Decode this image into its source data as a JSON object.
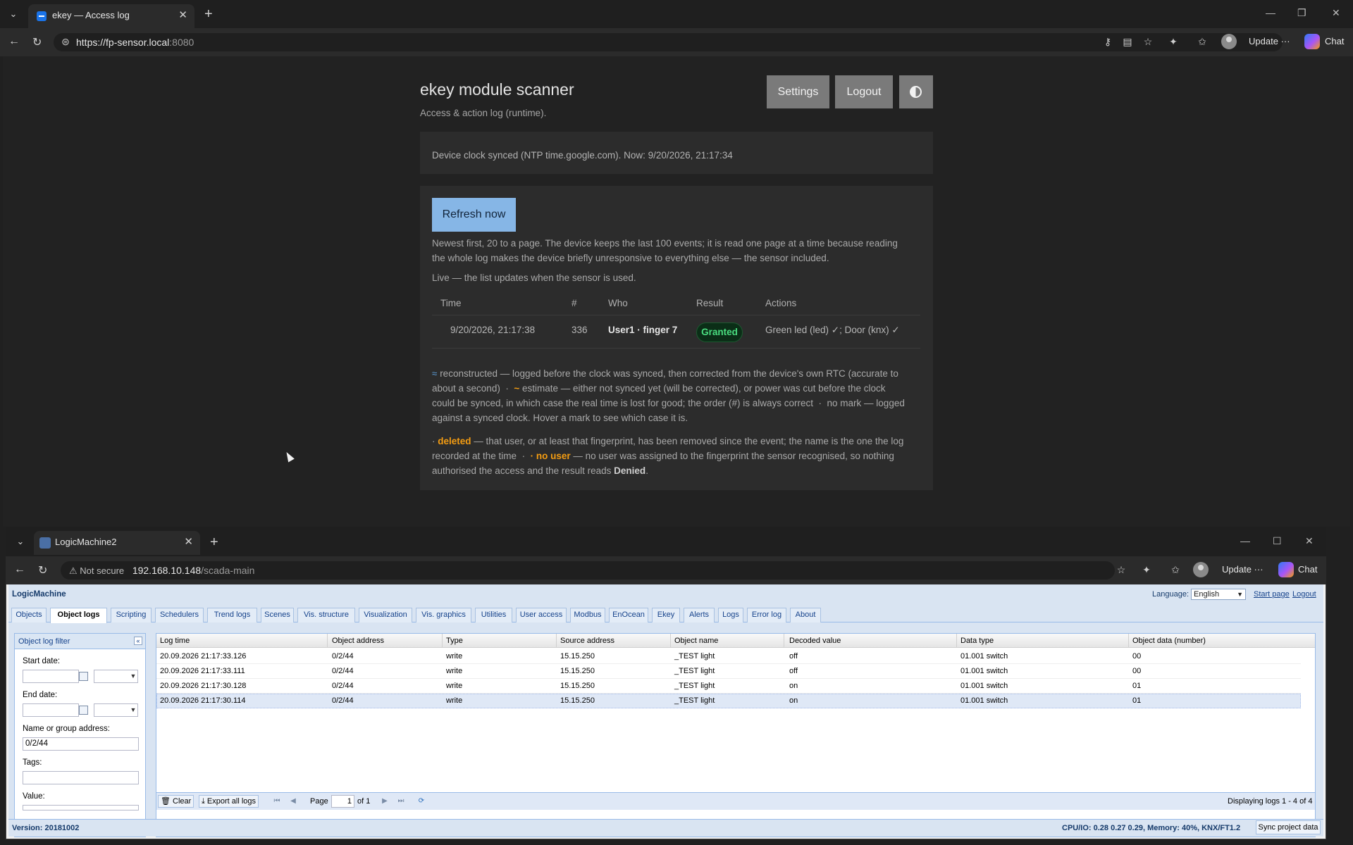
{
  "outer_browser": {
    "tab_title": "ekey — Access log",
    "address_host": "https://fp-sensor.local",
    "address_port": ":8080",
    "update_label": "Update",
    "chat_label": "Chat"
  },
  "ekey": {
    "title": "ekey module scanner",
    "subtitle": "Access & action log (runtime).",
    "settings_label": "Settings",
    "logout_label": "Logout",
    "clock_status": "Device clock synced (NTP time.google.com). Now: 9/20/2026, 21:17:34",
    "refresh_label": "Refresh now",
    "info_line1": "Newest first, 20 to a page. The device keeps the last 100 events; it is read one page at a time because reading",
    "info_line2": "the whole log makes the device briefly unresponsive to everything else — the sensor included.",
    "live_text": "Live — the list updates when the sensor is used.",
    "table_headers": {
      "time": "Time",
      "num": "#",
      "who": "Who",
      "result": "Result",
      "actions": "Actions"
    },
    "rows": [
      {
        "time": "9/20/2026, 21:17:38",
        "num": "336",
        "who": "User1 · finger 7",
        "result": "Granted",
        "actions": "Green led (led) ✓; Door (knx) ✓"
      }
    ],
    "legend_marks": {
      "reconstructed_mark": "≈",
      "reconstructed_text": "reconstructed — logged before the clock was synced, then corrected from the device's own RTC (accurate to",
      "reconstructed_text2": "about a second)",
      "sep": "·",
      "estimate_mark": "~",
      "estimate_text": "estimate — either not synced yet (will be corrected), or power was cut before the clock",
      "estimate_text2": "could be synced, in which case the real time is lost for good; the order (#) is always correct",
      "nomark_text": "no mark — logged",
      "nomark_text2": "against a synced clock. Hover a mark to see which case it is."
    },
    "legend_users": {
      "deleted_label": "deleted",
      "deleted_text": "— that user, or at least that fingerprint, has been removed since the event; the name is the one the log",
      "deleted_text2": "recorded at the time",
      "nouser_label": "no user",
      "nouser_text": "— no user was assigned to the fingerprint the sensor recognised, so nothing",
      "nouser_text2": "authorised the access and the result reads",
      "denied": "Denied"
    }
  },
  "inner_browser": {
    "tab_title": "LogicMachine2",
    "not_secure": "Not secure",
    "address_host": "192.168.10.148",
    "address_path": "/scada-main",
    "update_label": "Update",
    "chat_label": "Chat"
  },
  "lm": {
    "logo": "LogicMachine",
    "language_label": "Language:",
    "language_value": "English",
    "start_page": "Start page",
    "logout": "Logout",
    "tabs": [
      "Objects",
      "Object logs",
      "Scripting",
      "Schedulers",
      "Trend logs",
      "Scenes",
      "Vis. structure",
      "Visualization",
      "Vis. graphics",
      "Utilities",
      "User access",
      "Modbus",
      "EnOcean",
      "Ekey",
      "Alerts",
      "Logs",
      "Error log",
      "About"
    ],
    "active_tab": "Object logs",
    "filter": {
      "title": "Object log filter",
      "start_date": "Start date:",
      "end_date": "End date:",
      "name_label": "Name or group address:",
      "name_value": "0/2/44",
      "tags_label": "Tags:",
      "value_label": "Value:"
    },
    "grid_headers": [
      "Log time",
      "Object address",
      "Type",
      "Source address",
      "Object name",
      "Decoded value",
      "Data type",
      "Object data (number)"
    ],
    "grid_rows": [
      [
        "20.09.2026 21:17:33.126",
        "0/2/44",
        "write",
        "15.15.250",
        "_TEST light",
        "off",
        "01.001 switch",
        "00"
      ],
      [
        "20.09.2026 21:17:33.111",
        "0/2/44",
        "write",
        "15.15.250",
        "_TEST light",
        "off",
        "01.001 switch",
        "00"
      ],
      [
        "20.09.2026 21:17:30.128",
        "0/2/44",
        "write",
        "15.15.250",
        "_TEST light",
        "on",
        "01.001 switch",
        "01"
      ],
      [
        "20.09.2026 21:17:30.114",
        "0/2/44",
        "write",
        "15.15.250",
        "_TEST light",
        "on",
        "01.001 switch",
        "01"
      ]
    ],
    "pager": {
      "clear": "Clear",
      "export": "Export all logs",
      "page_label": "Page",
      "page_value": "1",
      "of_label": "of 1",
      "displaying": "Displaying logs 1 - 4 of 4"
    },
    "version": "Version: 20181002",
    "cpu": "CPU/IO: 0.28 0.27 0.29, Memory: 40%, KNX/FT1.2",
    "sync": "Sync project data"
  }
}
